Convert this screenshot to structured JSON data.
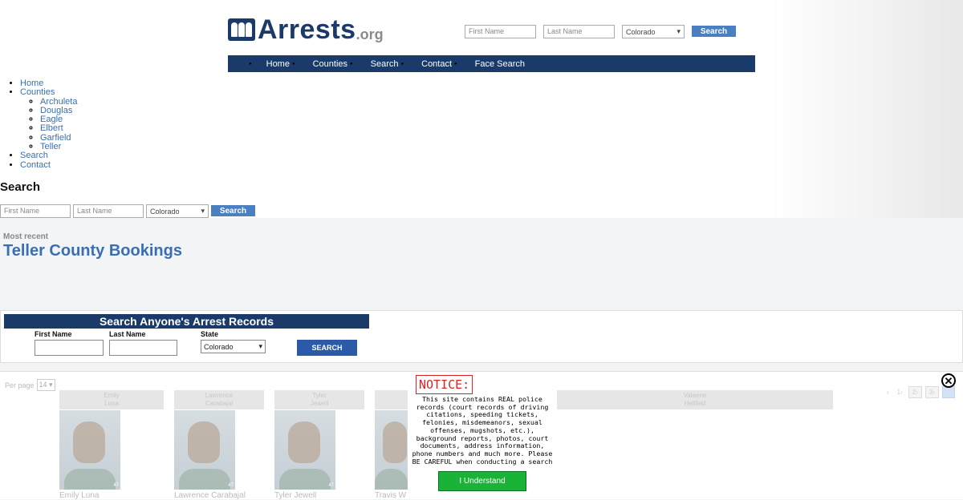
{
  "header": {
    "logo_text": "Arrests",
    "logo_suffix": ".org",
    "first_name_placeholder": "First Name",
    "last_name_placeholder": "Last Name",
    "state_selected": "Colorado",
    "search_label": "Search"
  },
  "nav": {
    "items": [
      "Home",
      "Counties",
      "Search",
      "Contact",
      "Face Search"
    ]
  },
  "menu": {
    "home": "Home",
    "counties": "Counties",
    "county_items": [
      "Archuleta",
      "Douglas",
      "Eagle",
      "Elbert",
      "Garfield",
      "Teller"
    ],
    "search": "Search",
    "contact": "Contact"
  },
  "search_section": {
    "heading": "Search",
    "first_name_placeholder": "First Name",
    "last_name_placeholder": "Last Name",
    "state_selected": "Colorado",
    "button": "Search"
  },
  "main": {
    "most_recent": "Most recent",
    "title": "Teller County Bookings"
  },
  "records": {
    "bar_title": "Search Anyone's Arrest Records",
    "first_name_label": "First Name",
    "last_name_label": "Last Name",
    "state_label": "State",
    "state_selected": "Colorado",
    "button": "SEARCH"
  },
  "results": {
    "per_page_label": "Per page",
    "per_page_value": "14",
    "cards": [
      {
        "head": "Emily\nLuna",
        "name": "Emily Luna",
        "wm": "47"
      },
      {
        "head": "Lawrence\nCarabajal",
        "name": "Lawrence Carabajal",
        "wm": "47"
      },
      {
        "head": "Tyler\nJewell",
        "name": "Tyler Jewell",
        "wm": "47"
      },
      {
        "head": "",
        "name": "Travis W",
        "wm": ""
      },
      {
        "head": "Valeene\nHellfeld",
        "name": "",
        "wm": ""
      }
    ],
    "pager": [
      "‹",
      "1›",
      "2›",
      "3›"
    ]
  },
  "notice": {
    "title": "NOTICE:",
    "body": "This site contains REAL police records (court records of driving citations, speeding tickets, felonies, misdemeanors, sexual offenses, mugshots, etc.), background reports, photos, court documents, address information, phone numbers and much more. Please BE CAREFUL when conducting a search",
    "button": "I Understand"
  }
}
